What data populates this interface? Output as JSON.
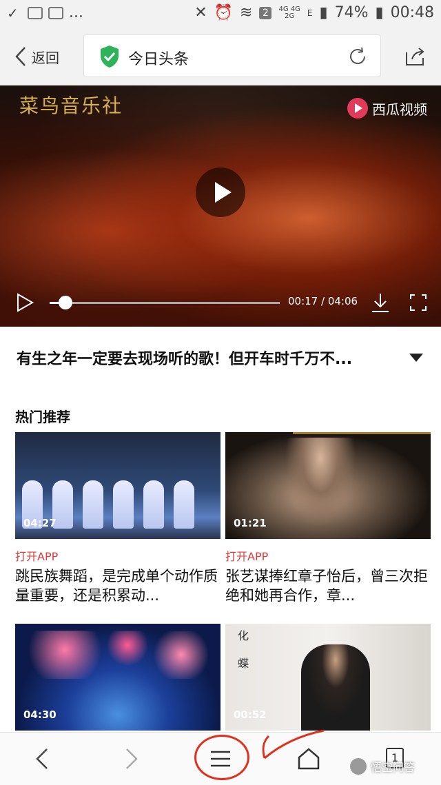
{
  "status_bar": {
    "left_icons": [
      "check-icon",
      "image-icon",
      "image-icon",
      "more-dots"
    ],
    "more": "...",
    "sim_badge": "2",
    "net_top": "4G 4G",
    "net_bottom": "2G",
    "net_e": "E",
    "battery": "74%",
    "time": "00:48"
  },
  "browser": {
    "back_label": "返回",
    "page_title": "今日头条"
  },
  "video": {
    "watermark_left": "菜鸟音乐社",
    "watermark_right": "西瓜视频",
    "current_time": "00:17",
    "duration": "04:06",
    "time_display": "00:17 / 04:06",
    "progress": 0.07
  },
  "article": {
    "headline": "有生之年一定要去现场听的歌！但开车时千万不..."
  },
  "recommend": {
    "section_title": "热门推荐",
    "cards": [
      {
        "duration": "04:27",
        "tag": "打开APP",
        "title": "跳民族舞蹈，是完成单个动作质量重要，还是积累动..."
      },
      {
        "duration": "01:21",
        "tag": "打开APP",
        "title": "张艺谋捧红章子怡后，曾三次拒绝和她再合作，章..."
      },
      {
        "duration": "04:30"
      },
      {
        "duration": "00:52"
      }
    ]
  },
  "bottom_nav": {
    "tab_count": "1"
  },
  "watermark": "悟空问答"
}
